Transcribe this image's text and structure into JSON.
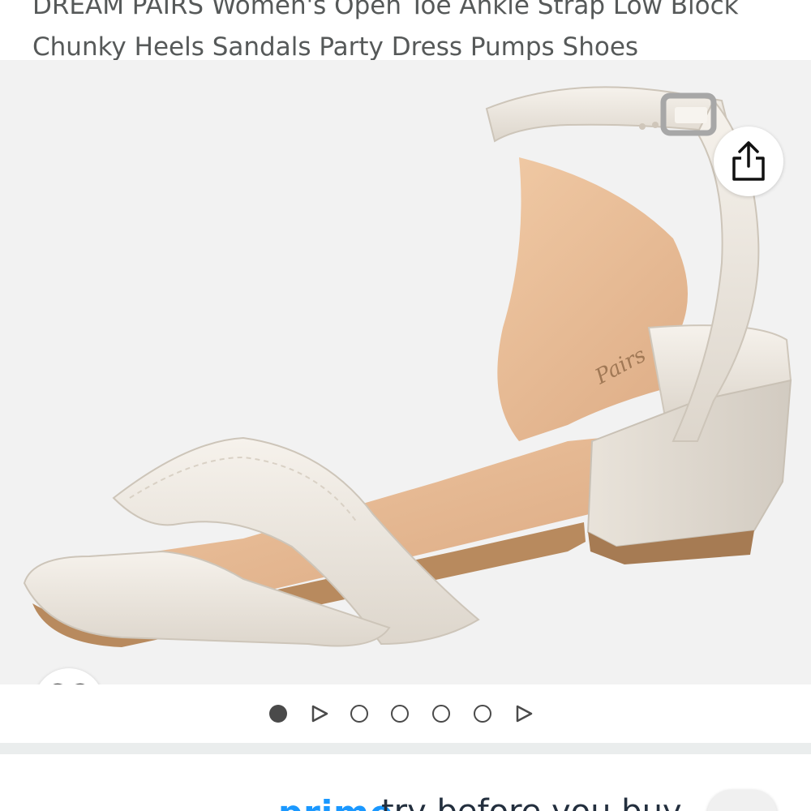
{
  "product": {
    "title_line1": "DREAM PAIRS Women's Open Toe Ankle Strap Low Block",
    "title_line2": "Chunky Heels Sandals Party Dress Pumps Shoes",
    "insole_brand": "Pairs"
  },
  "gallery": {
    "share_icon": "share-icon",
    "wishlist_icon": "heart-icon",
    "dots": [
      "active",
      "video",
      "image",
      "image",
      "image",
      "image",
      "video"
    ],
    "active_index": 0
  },
  "prime": {
    "logo": "prime",
    "tagline": "try before you buy"
  },
  "colors": {
    "title": "#565959",
    "gallery_bg": "#f2f2f2",
    "prime_blue": "#1a98ff",
    "sandal_strap": "#ece7df",
    "sandal_lining": "#e3b48e"
  }
}
